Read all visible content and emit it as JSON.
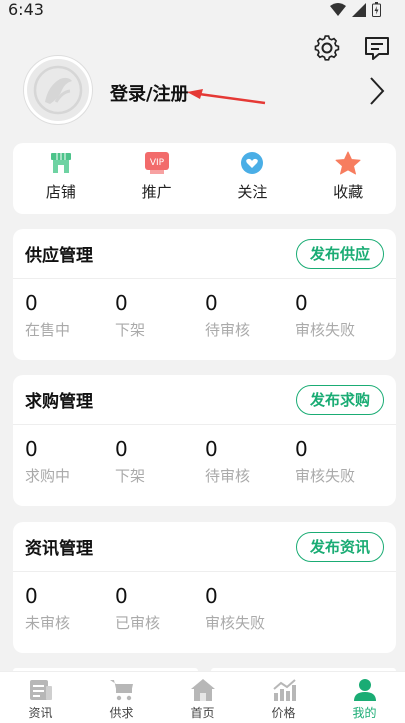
{
  "status": {
    "time": "6:43"
  },
  "header": {
    "settings_icon": "gear-icon",
    "message_icon": "message-icon"
  },
  "profile": {
    "login_label": "登录/注册"
  },
  "quick": [
    {
      "label": "店铺",
      "icon": "store-icon",
      "color": "#4cc38a"
    },
    {
      "label": "推广",
      "icon": "vip-icon",
      "color": "#f26b6b"
    },
    {
      "label": "关注",
      "icon": "heart-icon",
      "color": "#4aaee6"
    },
    {
      "label": "收藏",
      "icon": "star-icon",
      "color": "#f77d5f"
    }
  ],
  "supply": {
    "title": "供应管理",
    "button": "发布供应",
    "stats": [
      {
        "value": "0",
        "label": "在售中"
      },
      {
        "value": "0",
        "label": "下架"
      },
      {
        "value": "0",
        "label": "待审核"
      },
      {
        "value": "0",
        "label": "审核失败"
      }
    ]
  },
  "purchase": {
    "title": "求购管理",
    "button": "发布求购",
    "stats": [
      {
        "value": "0",
        "label": "求购中"
      },
      {
        "value": "0",
        "label": "下架"
      },
      {
        "value": "0",
        "label": "待审核"
      },
      {
        "value": "0",
        "label": "审核失败"
      }
    ]
  },
  "news": {
    "title": "资讯管理",
    "button": "发布资讯",
    "stats": [
      {
        "value": "0",
        "label": "未审核"
      },
      {
        "value": "0",
        "label": "已审核"
      },
      {
        "value": "0",
        "label": "审核失败"
      }
    ]
  },
  "tabs": [
    {
      "label": "资讯",
      "icon": "news-icon"
    },
    {
      "label": "供求",
      "icon": "cart-icon"
    },
    {
      "label": "首页",
      "icon": "home-icon"
    },
    {
      "label": "价格",
      "icon": "chart-icon"
    },
    {
      "label": "我的",
      "icon": "person-icon"
    }
  ],
  "colors": {
    "accent": "#1aac74",
    "annotation": "#e53935"
  }
}
